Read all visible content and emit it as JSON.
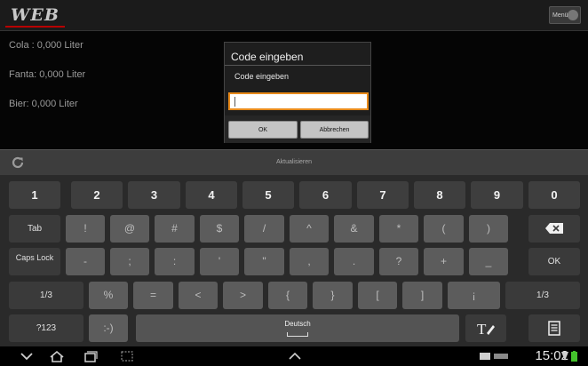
{
  "app": {
    "logo_text": "WEB",
    "menu_label": "Menü"
  },
  "drinks": [
    {
      "label": "Cola : 0,000 Liter"
    },
    {
      "label": "Fanta:  0,000 Liter"
    },
    {
      "label": "Bier:  0,000 Liter"
    }
  ],
  "dialog": {
    "title": "Code eingeben",
    "message": "Code eingeben",
    "input_value": "",
    "ok_label": "OK",
    "cancel_label": "Abbrechen"
  },
  "refresh": {
    "label": "Aktualisieren"
  },
  "keyboard": {
    "row1": [
      "1",
      "2",
      "3",
      "4",
      "5",
      "6",
      "7",
      "8",
      "9",
      "0"
    ],
    "row2": [
      "Tab",
      "!",
      "@",
      "#",
      "$",
      "/",
      "^",
      "&",
      "*",
      "(",
      ")"
    ],
    "row3": [
      "Caps Lock",
      "-",
      ";",
      ":",
      "'",
      "\"",
      ",",
      ".",
      "?",
      "+",
      "_",
      "OK"
    ],
    "row4": [
      "1/3",
      "%",
      "=",
      "<",
      ">",
      "{",
      "}",
      "[",
      "]",
      "¡",
      "1/3"
    ],
    "row5": {
      "mode_label": "?123",
      "emoji_label": ":-)",
      "space_label": "Deutsch"
    }
  },
  "status": {
    "time": "15:02"
  },
  "colors": {
    "accent": "#e88a1a",
    "logo_underline": "#b80000"
  }
}
